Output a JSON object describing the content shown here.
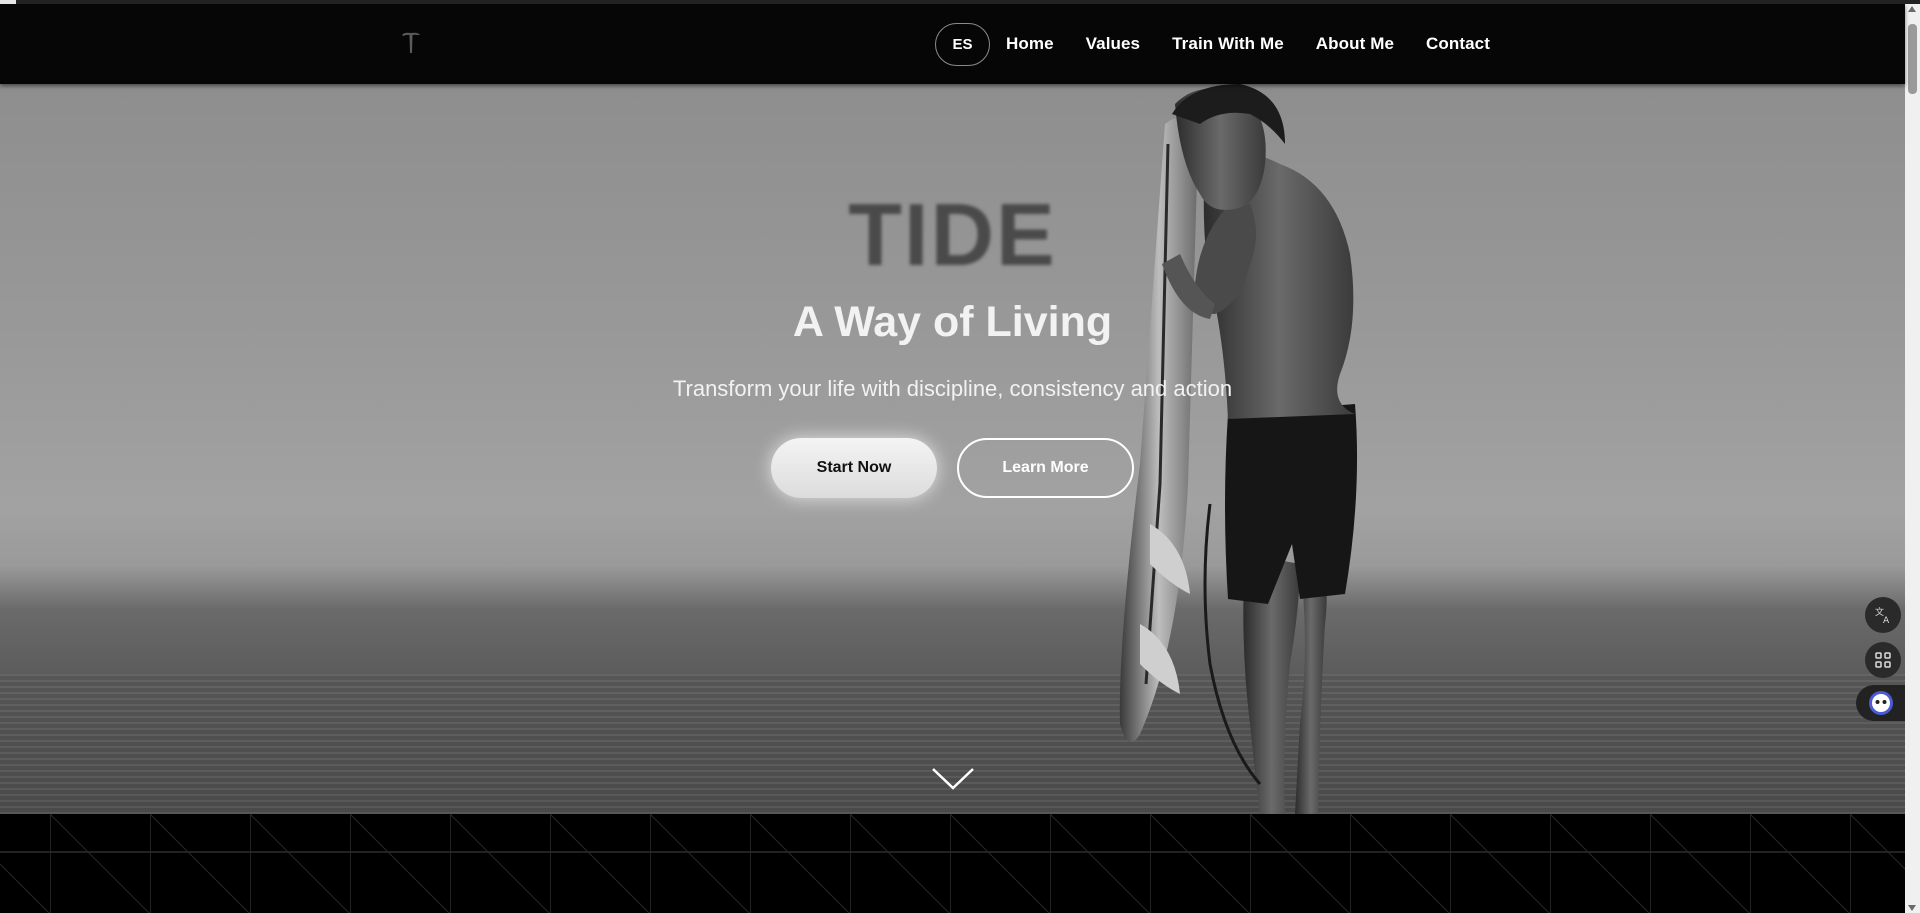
{
  "page": {
    "progress_percent": 1
  },
  "navbar": {
    "logo_icon": "tide-t-logo-icon",
    "language_button": "ES",
    "links": [
      {
        "label": "Home"
      },
      {
        "label": "Values"
      },
      {
        "label": "Train With Me"
      },
      {
        "label": "About Me"
      },
      {
        "label": "Contact"
      }
    ]
  },
  "hero": {
    "title": "TIDE",
    "subtitle": "A Way of Living",
    "tagline": "Transform your life with discipline, consistency and action",
    "primary_button": "Start Now",
    "secondary_button": "Learn More",
    "scroll_icon": "chevron-down-icon"
  },
  "widgets": {
    "translate_icon": "translate-icon",
    "apps_icon": "apps-grid-icon",
    "assistant_icon": "assistant-bot-icon"
  },
  "colors": {
    "nav_bg": "#060606",
    "hero_text": "#f2f2f2",
    "title": "#4a4a4a",
    "grid_bg": "#000000"
  }
}
